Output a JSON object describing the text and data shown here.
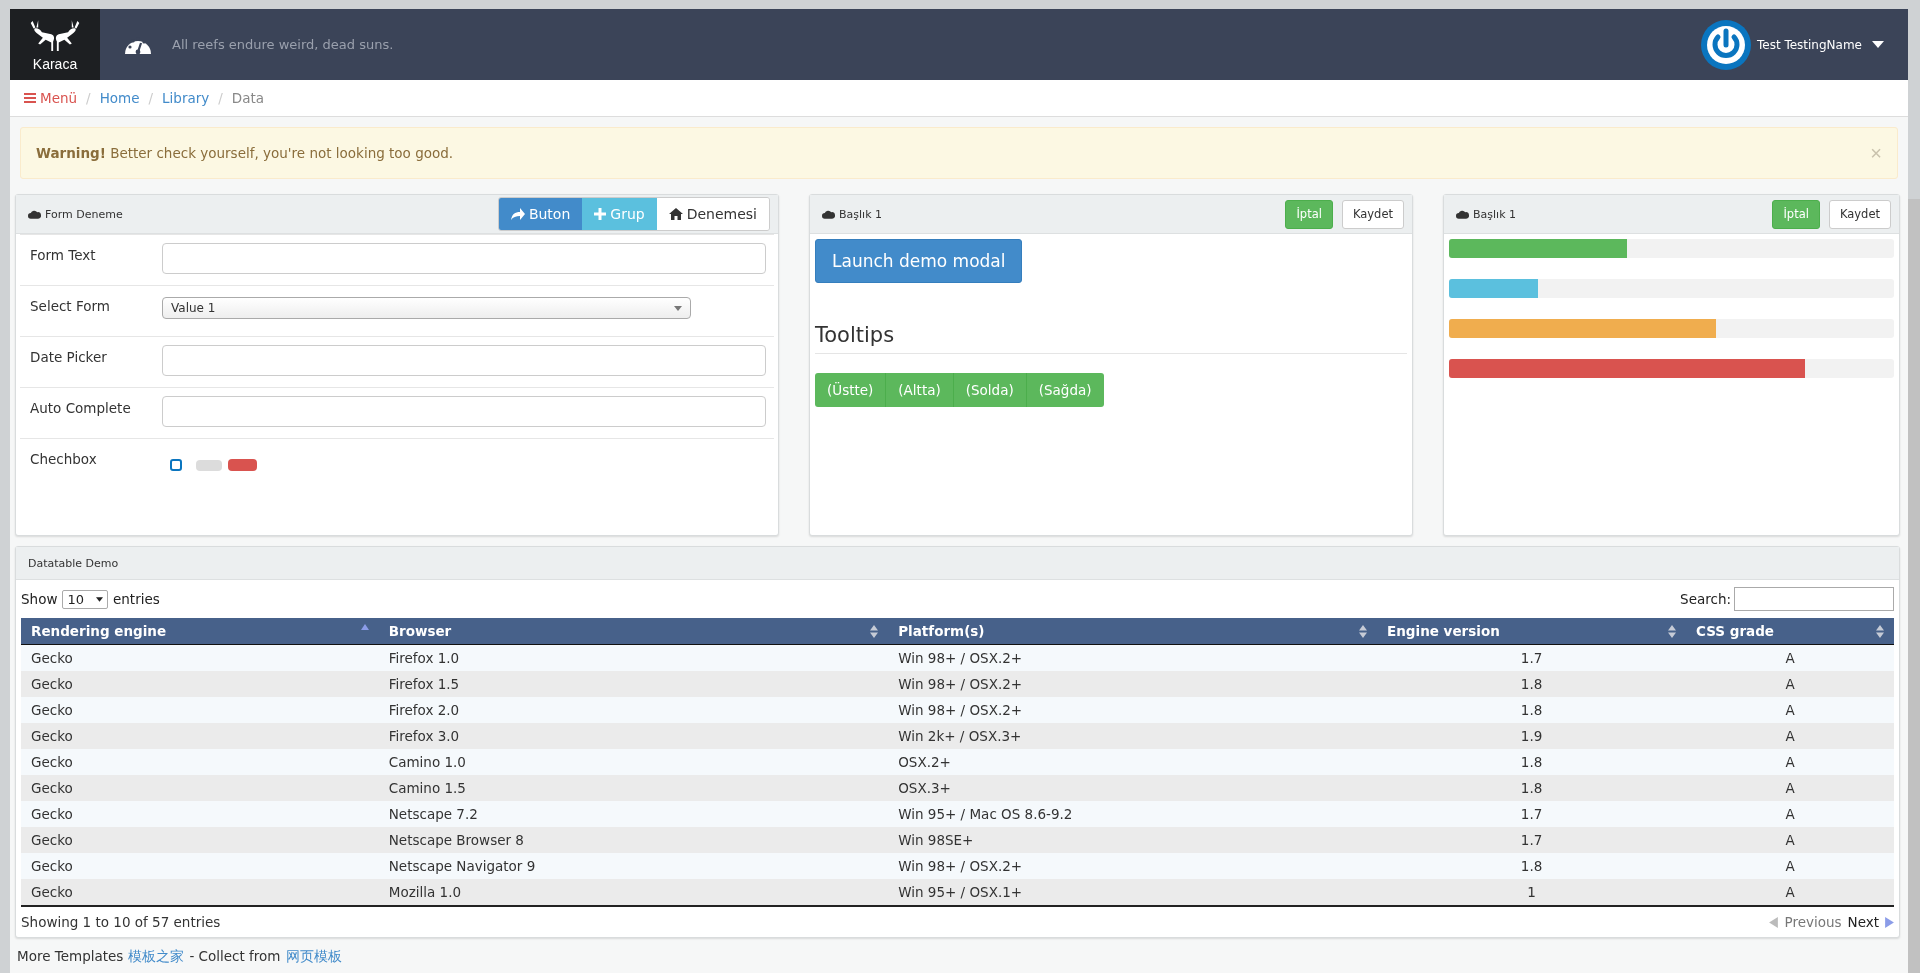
{
  "header": {
    "logo_text": "Karaca",
    "tagline": "All reefs endure weird, dead suns.",
    "user_name": "Test TestingName"
  },
  "breadcrumb": {
    "menu": "Menü",
    "separator": "/",
    "items": [
      {
        "label": "Home",
        "link": true
      },
      {
        "label": "Library",
        "link": true
      },
      {
        "label": "Data",
        "link": false
      }
    ]
  },
  "alert": {
    "title": "Warning!",
    "text": "Better check yourself, you're not looking too good.",
    "close": "×"
  },
  "form_panel": {
    "title": "Form Deneme",
    "buttons": [
      {
        "label": "Buton",
        "kind": "primary"
      },
      {
        "label": "Grup",
        "kind": "info"
      },
      {
        "label": "Denemesi",
        "kind": "default"
      }
    ],
    "fields": [
      {
        "label": "Form Text",
        "kind": "text"
      },
      {
        "label": "Select Form",
        "kind": "select",
        "value": "Value 1"
      },
      {
        "label": "Date Picker",
        "kind": "text"
      },
      {
        "label": "Auto Complete",
        "kind": "text"
      },
      {
        "label": "Chechbox",
        "kind": "checks",
        "checkbox": {
          "checked": false
        },
        "switches": [
          {
            "on": false
          },
          {
            "on": true
          }
        ]
      }
    ]
  },
  "modal_panel": {
    "title": "Başlık 1",
    "cancel": "İptal",
    "save": "Kaydet",
    "launch": "Launch demo modal",
    "tooltips_heading": "Tooltips",
    "tooltip_buttons": [
      "(Üstte)",
      "(Altta)",
      "(Solda)",
      "(Sağda)"
    ]
  },
  "progress_panel": {
    "title": "Başlık 1",
    "cancel": "İptal",
    "save": "Kaydet",
    "bars": [
      {
        "level": 0.4,
        "color": "#5cb85c"
      },
      {
        "level": 0.2,
        "color": "#5bc0de"
      },
      {
        "level": 0.6,
        "color": "#f0ad4e"
      },
      {
        "level": 0.8,
        "color": "#d9534f"
      }
    ]
  },
  "datatable": {
    "title": "Datatable Demo",
    "show_label": "Show",
    "page_size": "10",
    "entries_label": "entries",
    "search_label": "Search:",
    "columns": [
      {
        "label": "Rendering engine",
        "sorted": true
      },
      {
        "label": "Browser",
        "sorted": false
      },
      {
        "label": "Platform(s)",
        "sorted": false
      },
      {
        "label": "Engine version",
        "sorted": false
      },
      {
        "label": "CSS grade",
        "sorted": false
      }
    ],
    "rows": [
      [
        "Gecko",
        "Firefox 1.0",
        "Win 98+ / OSX.2+",
        "1.7",
        "A"
      ],
      [
        "Gecko",
        "Firefox 1.5",
        "Win 98+ / OSX.2+",
        "1.8",
        "A"
      ],
      [
        "Gecko",
        "Firefox 2.0",
        "Win 98+ / OSX.2+",
        "1.8",
        "A"
      ],
      [
        "Gecko",
        "Firefox 3.0",
        "Win 2k+ / OSX.3+",
        "1.9",
        "A"
      ],
      [
        "Gecko",
        "Camino 1.0",
        "OSX.2+",
        "1.8",
        "A"
      ],
      [
        "Gecko",
        "Camino 1.5",
        "OSX.3+",
        "1.8",
        "A"
      ],
      [
        "Gecko",
        "Netscape 7.2",
        "Win 95+ / Mac OS 8.6-9.2",
        "1.7",
        "A"
      ],
      [
        "Gecko",
        "Netscape Browser 8",
        "Win 98SE+",
        "1.7",
        "A"
      ],
      [
        "Gecko",
        "Netscape Navigator 9",
        "Win 98+ / OSX.2+",
        "1.8",
        "A"
      ],
      [
        "Gecko",
        "Mozilla 1.0",
        "Win 95+ / OSX.1+",
        "1",
        "A"
      ]
    ],
    "info": "Showing 1 to 10 of 57 entries",
    "previous": "Previous",
    "next": "Next"
  },
  "footer": {
    "text": "More Templates",
    "link1": "模板之家",
    "middle": "- Collect from",
    "link2": "网页模板"
  }
}
